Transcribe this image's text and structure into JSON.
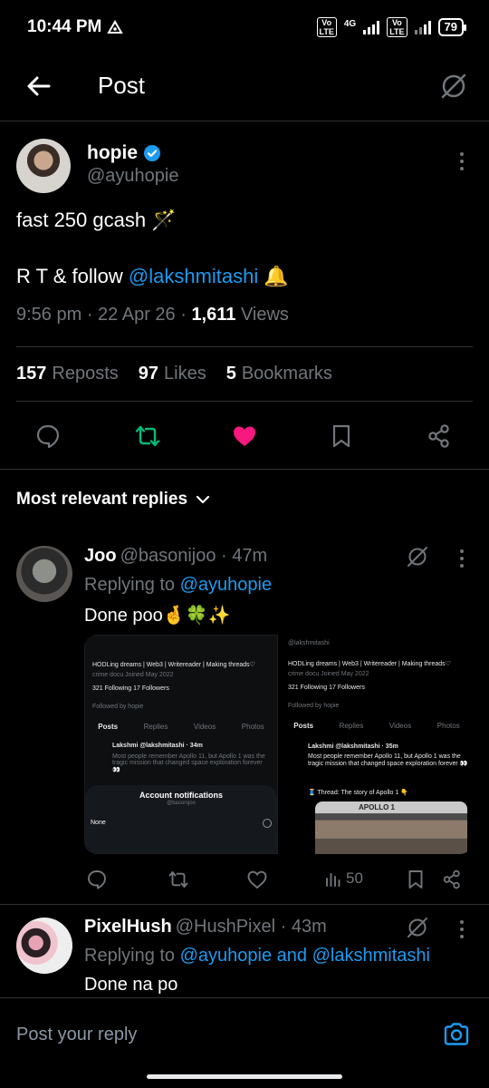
{
  "status": {
    "time": "10:44 PM",
    "network": "4G",
    "volte": "Vo\nLTE",
    "battery": "79"
  },
  "header": {
    "title": "Post"
  },
  "post": {
    "author_name": "hopie",
    "author_handle": "@ayuhopie",
    "text_line1": "fast 250 gcash 🪄",
    "text_line2_prefix": "R T & follow ",
    "text_line2_mention": "@lakshmitashi",
    "text_line2_suffix": " 🔔",
    "time": "9:56 pm · 22 Apr 26 · ",
    "views_count": "1,611",
    "views_label": " Views",
    "reposts_count": "157",
    "reposts_label": "Reposts",
    "likes_count": "97",
    "likes_label": "Likes",
    "bookmarks_count": "5",
    "bookmarks_label": "Bookmarks"
  },
  "colors": {
    "accent": "#1d9bf0",
    "repost_active": "#00ba7c",
    "like_active": "#f91880",
    "muted": "#71767b"
  },
  "replies_header": {
    "label": "Most relevant replies"
  },
  "replies": [
    {
      "name": "Joo",
      "handle": "@basonijoo",
      "time": " · 47m",
      "replying_label": "Replying to ",
      "replying_to": "@ayuhopie",
      "text": "Done poo🤞🍀✨",
      "views": "50",
      "media": {
        "left": {
          "bio": "HODLing dreams | Web3 | Writereader | Making threads♡",
          "meta": "crime docu  Joined May 2022",
          "follow": "321 Following  17 Followers",
          "followed_by": "Followed by hopie",
          "tabs": [
            "Posts",
            "Replies",
            "Videos",
            "Photos"
          ],
          "post_name": "Lakshmi @lakshmitashi · 34m",
          "post_text": "Most people remember Apollo 11, but Apollo 1 was the tragic mission that changed space exploration forever 👀",
          "sheet_title": "Account notifications",
          "sheet_sub": "@basonijoo",
          "sheet_option": "None"
        },
        "right": {
          "handle": "@lakshmitashi",
          "bio": "HODLing dreams | Web3 | Writereader | Making threads♡",
          "meta": "crime docu  Joined May 2022",
          "follow": "321 Following  17 Followers",
          "followed_by": "Followed by hopie",
          "tabs": [
            "Posts",
            "Replies",
            "Videos",
            "Photos"
          ],
          "post_name": "Lakshmi @lakshmitashi · 35m",
          "post_text": "Most people remember Apollo 11, but Apollo 1 was the tragic mission that changed space exploration forever 👀",
          "thread": "🧵 Thread: The story of Apollo 1 👇",
          "image_label": "APOLLO 1"
        }
      }
    },
    {
      "name": "PixelHush",
      "handle": "@HushPixel",
      "time": " · 43m",
      "replying_label": "Replying to ",
      "replying_to": "@ayuhopie and @lakshmitashi",
      "text": "Done na po"
    }
  ],
  "composer": {
    "placeholder": "Post your reply"
  }
}
